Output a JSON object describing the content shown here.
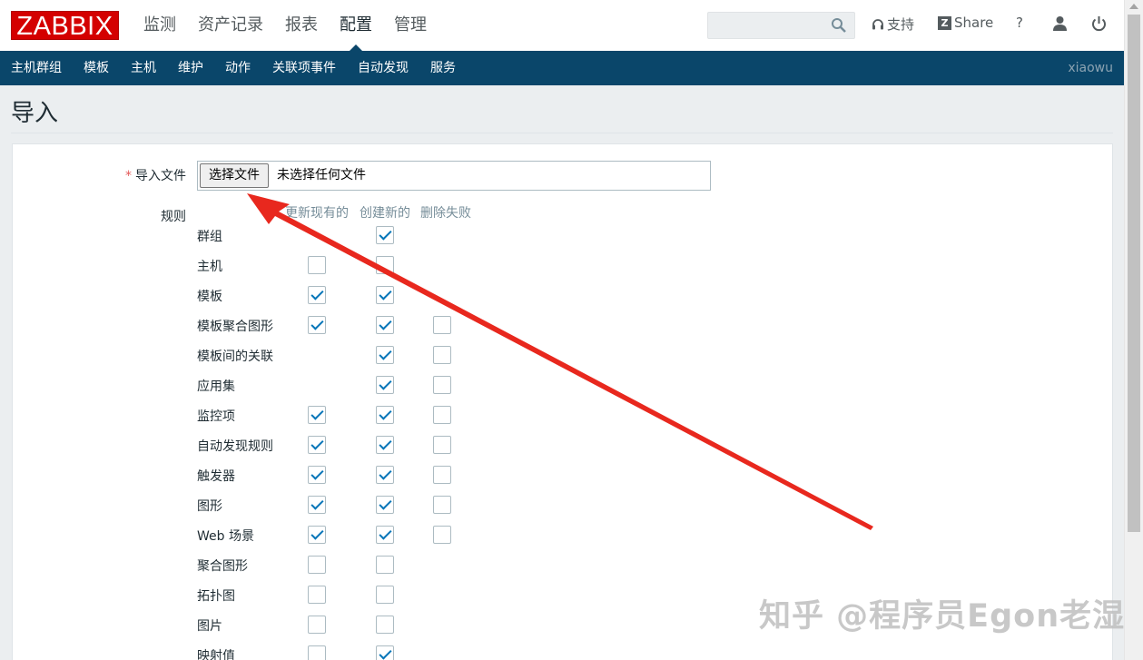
{
  "header": {
    "logo": "ZABBIX",
    "menu": [
      {
        "label": "监测",
        "selected": false
      },
      {
        "label": "资产记录",
        "selected": false
      },
      {
        "label": "报表",
        "selected": false
      },
      {
        "label": "配置",
        "selected": true
      },
      {
        "label": "管理",
        "selected": false
      }
    ],
    "search_placeholder": "",
    "support_label": "支持",
    "share_label": "Share",
    "help_label": "?"
  },
  "subnav": {
    "items": [
      "主机群组",
      "模板",
      "主机",
      "维护",
      "动作",
      "关联项事件",
      "自动发现",
      "服务"
    ],
    "user": "xiaowu"
  },
  "page": {
    "title": "导入",
    "import_file_label": "导入文件",
    "choose_file_button": "选择文件",
    "no_file_text": "未选择任何文件",
    "rules_label": "规则",
    "columns": [
      "更新现有的",
      "创建新的",
      "删除失败"
    ]
  },
  "rules": [
    {
      "name": "群组",
      "update": null,
      "create": true,
      "delete": null
    },
    {
      "name": "主机",
      "update": false,
      "create": false,
      "delete": null
    },
    {
      "name": "模板",
      "update": true,
      "create": true,
      "delete": null
    },
    {
      "name": "模板聚合图形",
      "update": true,
      "create": true,
      "delete": false
    },
    {
      "name": "模板间的关联",
      "update": null,
      "create": true,
      "delete": false
    },
    {
      "name": "应用集",
      "update": null,
      "create": true,
      "delete": false
    },
    {
      "name": "监控项",
      "update": true,
      "create": true,
      "delete": false
    },
    {
      "name": "自动发现规则",
      "update": true,
      "create": true,
      "delete": false
    },
    {
      "name": "触发器",
      "update": true,
      "create": true,
      "delete": false
    },
    {
      "name": "图形",
      "update": true,
      "create": true,
      "delete": false
    },
    {
      "name": "Web 场景",
      "update": true,
      "create": true,
      "delete": false
    },
    {
      "name": "聚合图形",
      "update": false,
      "create": false,
      "delete": null
    },
    {
      "name": "拓扑图",
      "update": false,
      "create": false,
      "delete": null
    },
    {
      "name": "图片",
      "update": false,
      "create": false,
      "delete": null
    },
    {
      "name": "映射值",
      "update": false,
      "create": true,
      "delete": null
    }
  ],
  "watermark": "知乎 @程序员Egon老湿",
  "colors": {
    "brand": "#d40000",
    "nav": "#0a466a",
    "check": "#0275b8",
    "arrow": "#e8281e"
  }
}
